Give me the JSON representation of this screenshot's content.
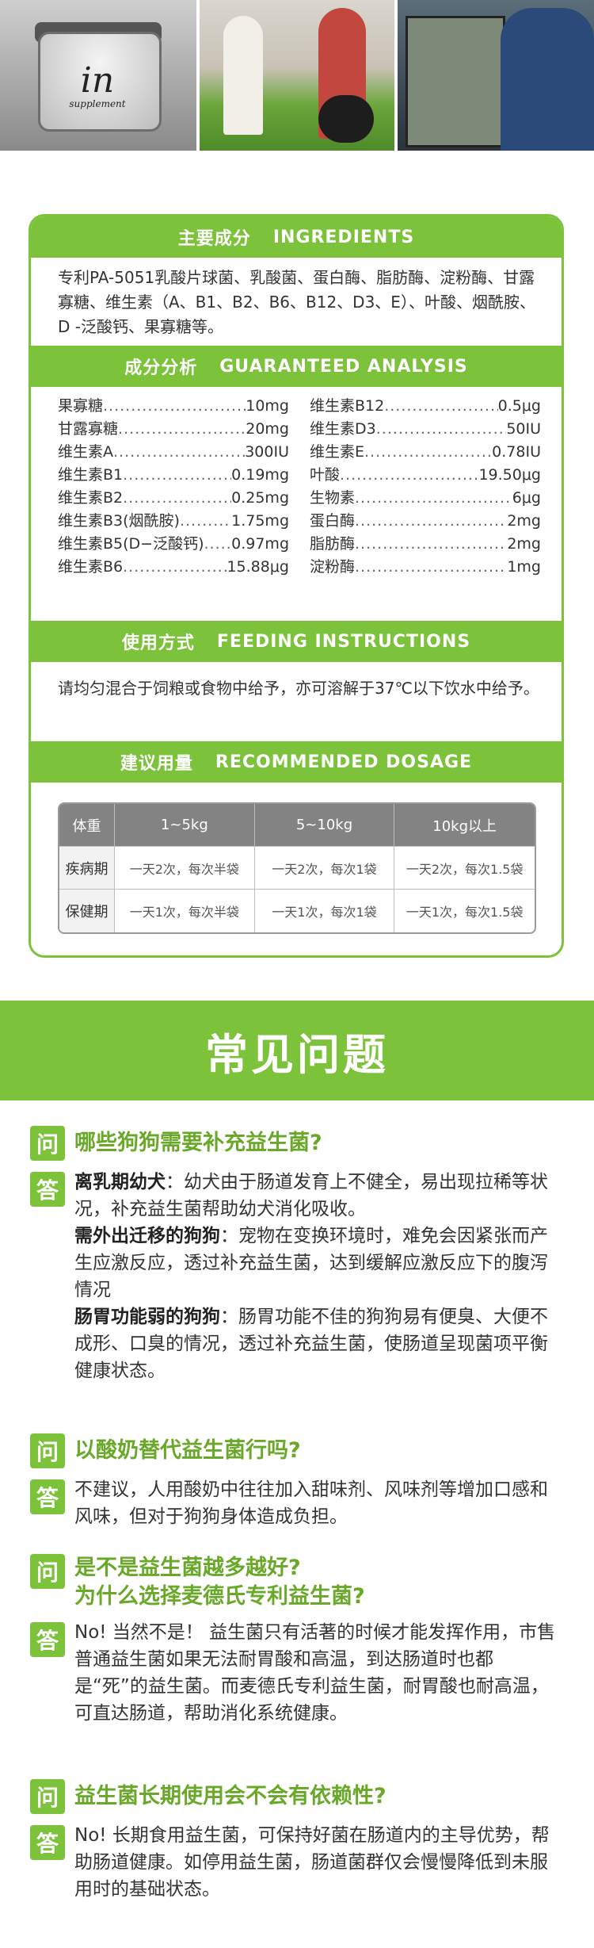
{
  "photos": {
    "jar_label_big": "in",
    "jar_label_small": "supplement"
  },
  "ingredients": {
    "title_cn": "主要成分",
    "title_en": "INGREDIENTS",
    "text": "专利PA-5051乳酸片球菌、乳酸菌、蛋白酶、脂肪酶、淀粉酶、甘露寡糖、维生素（A、B1、B2、B6、B12、D3、E）、叶酸、烟酰胺、D -泛酸钙、果寡糖等。"
  },
  "analysis": {
    "title_cn": "成分分析",
    "title_en": "GUARANTEED ANALYSIS",
    "items": [
      {
        "name": "果寡糖",
        "value": "10mg"
      },
      {
        "name": "维生素B12",
        "value": "0.5μg"
      },
      {
        "name": "甘露寡糖",
        "value": "20mg"
      },
      {
        "name": "维生素D3",
        "value": "50IU"
      },
      {
        "name": "维生素A",
        "value": "300IU"
      },
      {
        "name": "维生素E",
        "value": "0.78IU"
      },
      {
        "name": "维生素B1",
        "value": "0.19mg"
      },
      {
        "name": "叶酸",
        "value": "19.50μg"
      },
      {
        "name": "维生素B2",
        "value": "0.25mg"
      },
      {
        "name": "生物素",
        "value": "6μg"
      },
      {
        "name": "维生素B3(烟酰胺)",
        "value": "1.75mg"
      },
      {
        "name": "蛋白酶",
        "value": "2mg"
      },
      {
        "name": "维生素B5(D−泛酸钙)",
        "value": "0.97mg"
      },
      {
        "name": "脂肪酶",
        "value": "2mg"
      },
      {
        "name": "维生素B6",
        "value": "15.88μg"
      },
      {
        "name": "淀粉酶",
        "value": "1mg"
      }
    ]
  },
  "feeding": {
    "title_cn": "使用方式",
    "title_en": "FEEDING INSTRUCTIONS",
    "text": "请均匀混合于饲粮或食物中给予，亦可溶解于37℃以下饮水中给予。"
  },
  "dosage": {
    "title_cn": "建议用量",
    "title_en": "RECOMMENDED DOSAGE",
    "header": [
      "体重",
      "1~5kg",
      "5~10kg",
      "10kg以上"
    ],
    "rows": [
      [
        "疾病期",
        "一天2次，每次半袋",
        "一天2次，每次1袋",
        "一天2次，每次1.5袋"
      ],
      [
        "保健期",
        "一天1次，每次半袋",
        "一天1次，每次1袋",
        "一天1次，每次1.5袋"
      ]
    ]
  },
  "faq": {
    "title": "常见问题",
    "q_badge": "问",
    "a_badge": "答",
    "items": [
      {
        "question": "哪些狗狗需要补充益生菌?",
        "answer_parts": [
          {
            "bold": "离乳期幼犬",
            "text": "：幼犬由于肠道发育上不健全，易出现拉稀等状况，补充益生菌帮助幼犬消化吸收。"
          },
          {
            "bold": "需外出迁移的狗狗",
            "text": "：宠物在变换环境时，难免会因紧张而产生应激反应，透过补充益生菌，达到缓解应激反应下的腹泻情况"
          },
          {
            "bold": "肠胃功能弱的狗狗",
            "text": "：肠胃功能不佳的狗狗易有便臭、大便不成形、口臭的情况，透过补充益生菌，使肠道呈现菌项平衡健康状态。"
          }
        ]
      },
      {
        "question": "以酸奶替代益生菌行吗?",
        "answer": "不建议，人用酸奶中往往加入甜味剂、风味剂等增加口感和风味，但对于狗狗身体造成负担。"
      },
      {
        "question": "是不是益生菌越多越好?",
        "question2": "为什么选择麦德氏专利益生菌?",
        "answer": "No! 当然不是！ 益生菌只有活著的时候才能发挥作用，市售普通益生菌如果无法耐胃酸和高温，到达肠道时也都是“死”的益生菌。而麦德氏专利益生菌，耐胃酸也耐高温，可直达肠道，帮助消化系统健康。"
      },
      {
        "question": "益生菌长期使用会不会有依赖性?",
        "answer": "No! 长期食用益生菌，可保持好菌在肠道内的主导优势，帮助肠道健康。如停用益生菌，肠道菌群仅会慢慢降低到未服用时的基础状态。"
      }
    ]
  },
  "colors": {
    "accent": "#7cc23a",
    "table_header": "#838383"
  }
}
